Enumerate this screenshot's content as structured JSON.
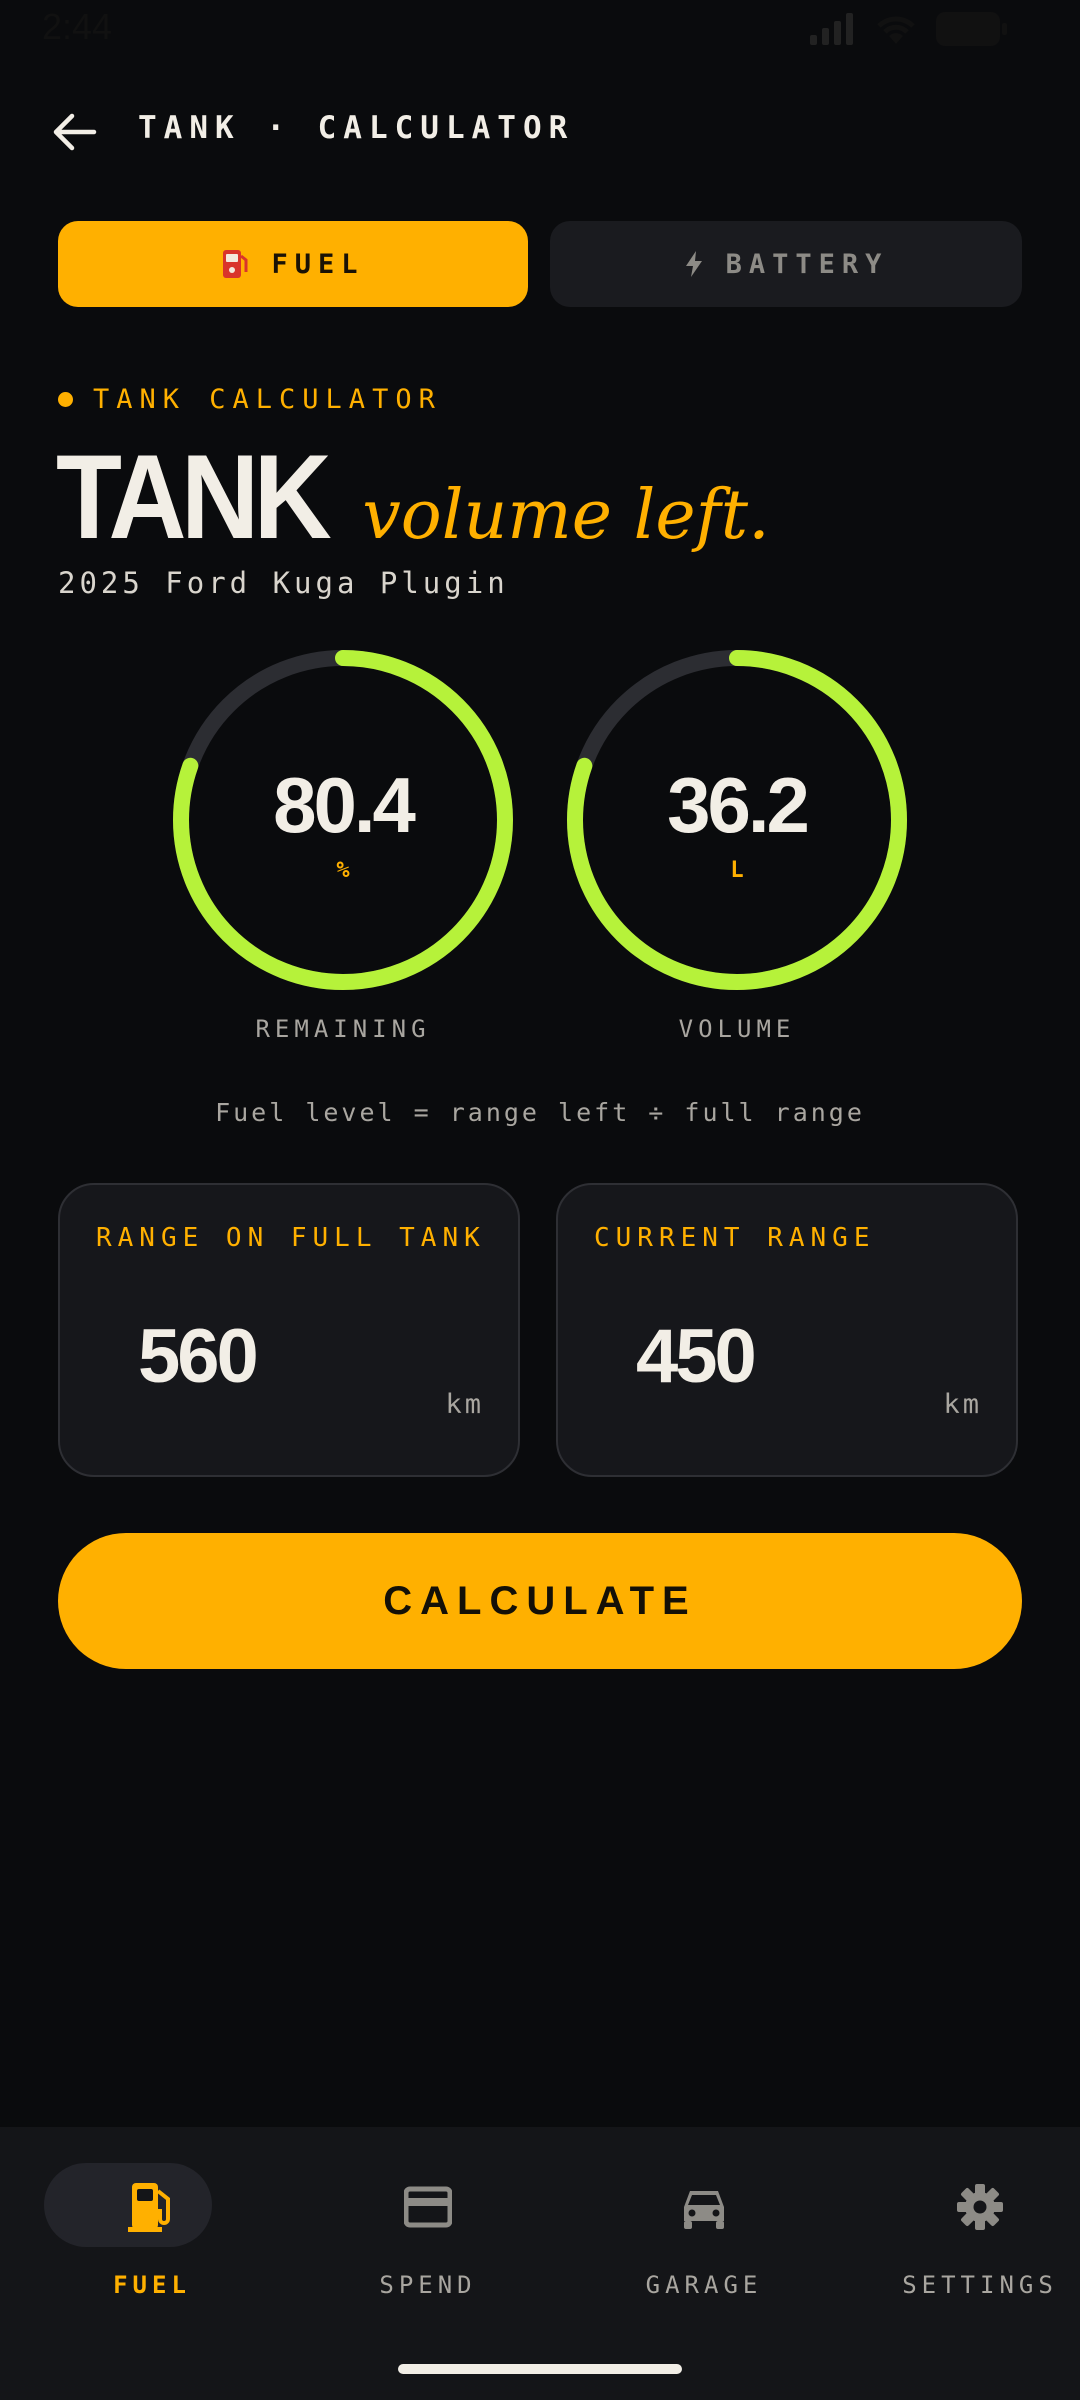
{
  "status_bar": {
    "time": "2:44"
  },
  "header": {
    "title": "TANK · CALCULATOR"
  },
  "mode_tabs": [
    {
      "label": "FUEL",
      "icon": "fuel-pump-icon",
      "active": true
    },
    {
      "label": "BATTERY",
      "icon": "bolt-icon",
      "active": false
    }
  ],
  "hero": {
    "eyebrow": "TANK CALCULATOR",
    "title_bold": "TANK",
    "title_italic": "volume left.",
    "vehicle": "2025 Ford Kuga Plugin"
  },
  "gauges": [
    {
      "value": "80.4",
      "unit": "%",
      "label": "REMAINING",
      "fill_fraction": 0.804
    },
    {
      "value": "36.2",
      "unit": "L",
      "label": "VOLUME",
      "fill_fraction": 0.804
    }
  ],
  "formula": "Fuel level = range left ÷ full range",
  "inputs": [
    {
      "label": "RANGE ON FULL TANK",
      "value": "560",
      "unit": "km"
    },
    {
      "label": "CURRENT RANGE",
      "value": "450",
      "unit": "km"
    }
  ],
  "calculate_label": "CALCULATE",
  "bottom_nav": [
    {
      "label": "FUEL",
      "icon": "fuel-pump-icon",
      "active": true
    },
    {
      "label": "SPEND",
      "icon": "credit-card-icon",
      "active": false
    },
    {
      "label": "GARAGE",
      "icon": "car-icon",
      "active": false
    },
    {
      "label": "SETTINGS",
      "icon": "gear-icon",
      "active": false
    }
  ],
  "colors": {
    "background": "#0a0b0d",
    "accent": "#ffb000",
    "gauge_fill": "#b6f23a",
    "gauge_track": "#2c2d32",
    "card": "#16171b"
  }
}
